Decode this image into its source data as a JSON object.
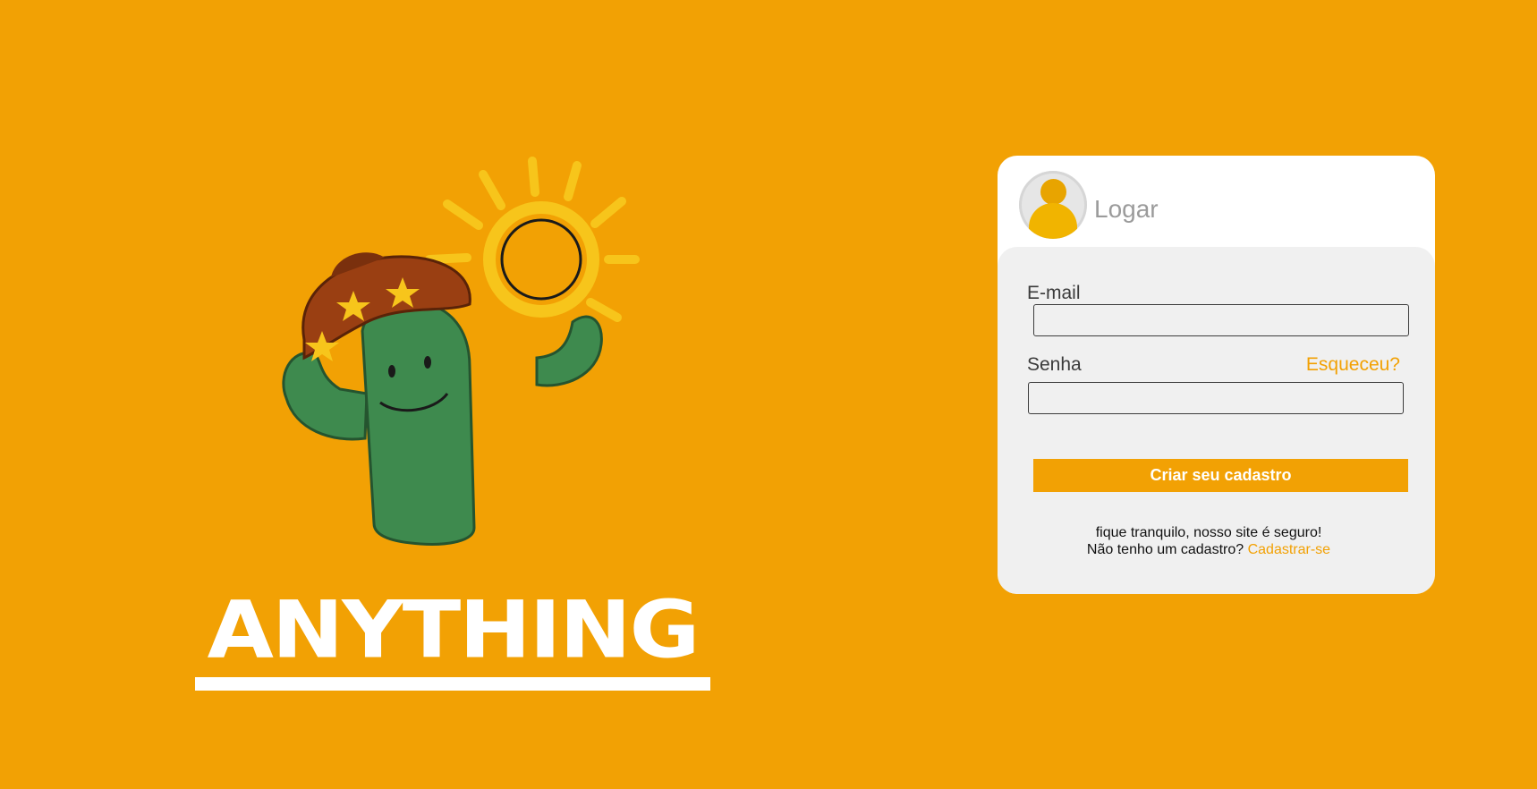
{
  "brand": {
    "name": "Anything"
  },
  "login": {
    "title": "Logar",
    "email_label": "E-mail",
    "email_value": "",
    "password_label": "Senha",
    "password_value": "",
    "forgot_link": "Esqueceu?",
    "submit_button": "Criar seu cadastro",
    "security_note": "fique tranquilo, nosso site é seguro!",
    "no_account_text": "Não tenho um cadastro? ",
    "signup_link": "Cadastrar-se"
  },
  "colors": {
    "background": "#F2A104",
    "accent": "#F2A104",
    "card": "#FFFFFF",
    "panel": "#F0F0F0"
  },
  "icons": {
    "avatar": "user-avatar-icon",
    "mascot": "cactus-sombrero-sun-illustration"
  }
}
